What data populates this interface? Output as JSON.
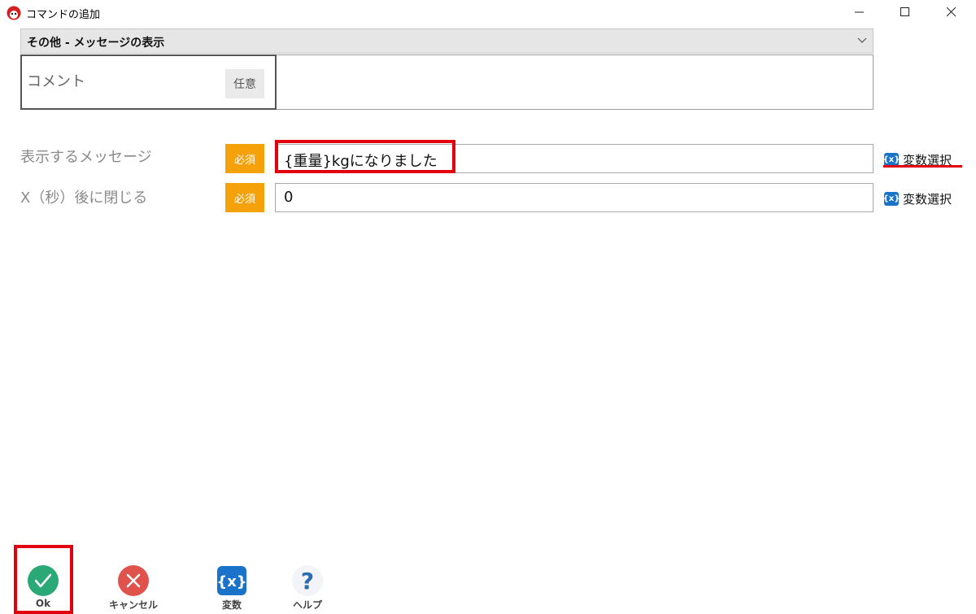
{
  "window": {
    "title": "コマンドの追加",
    "controls": {
      "minimize": "minimize-icon",
      "maximize": "maximize-icon",
      "close": "close-icon"
    }
  },
  "command_select": {
    "value": "その他 - メッセージの表示"
  },
  "comment": {
    "label": "コメント",
    "badge": "任意",
    "value": ""
  },
  "fields": [
    {
      "label": "表示するメッセージ",
      "badge": "必須",
      "value": "{重量}kgになりました",
      "var_button": "変数選択"
    },
    {
      "label": "X（秒）後に閉じる",
      "badge": "必須",
      "value": "0",
      "var_button": "変数選択"
    }
  ],
  "var_icon_text": "{x}",
  "buttons": {
    "ok": "Ok",
    "cancel": "キャンセル",
    "variables": "変数",
    "help": "ヘルプ"
  },
  "colors": {
    "required": "#f5a20a",
    "highlight": "#e2000f",
    "ok_green": "#2aa876",
    "cancel_red": "#e0524c",
    "var_blue": "#1a73c9",
    "help_blue": "#2b6cb0"
  }
}
